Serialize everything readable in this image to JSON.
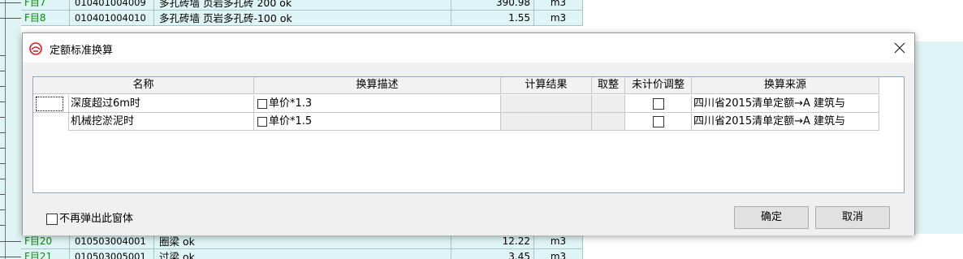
{
  "background_sheet": {
    "rows": [
      {
        "id": "F目7",
        "code": "010401004009",
        "desc": "多孔砖墙 页岩多孔砖 200 ok",
        "qty": "390.98",
        "unit": "m3"
      },
      {
        "id": "F目8",
        "code": "010401004010",
        "desc": "多孔砖墙 页岩多孔砖-100 ok",
        "qty": "1.55",
        "unit": "m3"
      },
      {
        "id": "F目20",
        "code": "010503004001",
        "desc": "圈梁 ok",
        "qty": "12.22",
        "unit": "m3"
      },
      {
        "id": "F目21",
        "code": "010503005001",
        "desc": "过梁 ok",
        "qty": "3.45",
        "unit": "m3"
      }
    ]
  },
  "dialog": {
    "title": "定额标准换算",
    "icon": "app-logo-icon",
    "close_icon": "close-icon",
    "table": {
      "columns": [
        "名称",
        "换算描述",
        "计算结果",
        "取整",
        "未计价调整",
        "换算来源"
      ],
      "rows": [
        {
          "name": "深度超过6m时",
          "desc": "单价*1.3",
          "result": "",
          "round": "",
          "unpriced_checked": false,
          "source": "四川省2015清单定额→A 建筑与"
        },
        {
          "name": "机械挖淤泥时",
          "desc": "单价*1.5",
          "result": "",
          "round": "",
          "unpriced_checked": false,
          "source": "四川省2015清单定额→A 建筑与"
        }
      ]
    },
    "no_popup_label": "不再弹出此窗体",
    "no_popup_checked": false,
    "ok_label": "确定",
    "cancel_label": "取消"
  }
}
